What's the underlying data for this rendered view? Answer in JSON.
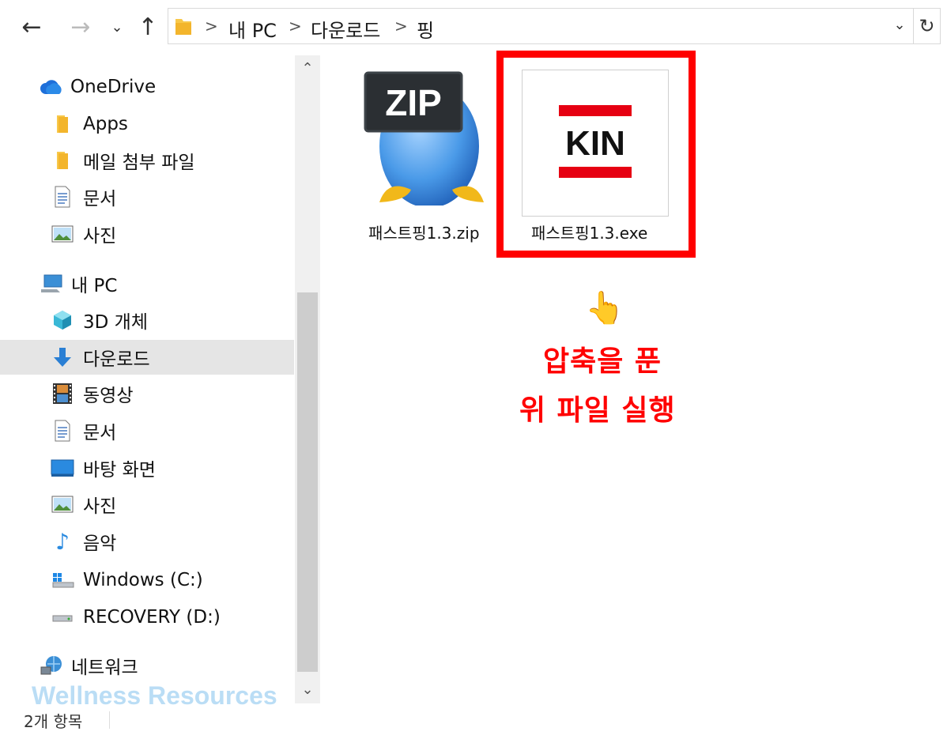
{
  "address_bar": {
    "back_icon": "←",
    "forward_icon": "→",
    "history_icon": "⌄",
    "up_icon": "↑",
    "crumbs": [
      "내 PC",
      "다운로드",
      "핑"
    ],
    "separator": ">",
    "dropdown_icon": "⌄",
    "refresh_icon": "↻"
  },
  "nav": {
    "items": [
      {
        "label": "OneDrive",
        "icon": "onedrive-cloud-icon"
      },
      {
        "label": "Apps",
        "icon": "folder-icon"
      },
      {
        "label": "메일 첨부 파일",
        "icon": "folder-icon"
      },
      {
        "label": "문서",
        "icon": "document-icon"
      },
      {
        "label": "사진",
        "icon": "picture-icon"
      },
      {
        "label": "내 PC",
        "icon": "computer-icon"
      },
      {
        "label": "3D 개체",
        "icon": "cube-icon"
      },
      {
        "label": "다운로드",
        "icon": "download-arrow-icon",
        "selected": true
      },
      {
        "label": "동영상",
        "icon": "film-icon"
      },
      {
        "label": "문서",
        "icon": "document-icon"
      },
      {
        "label": "바탕 화면",
        "icon": "desktop-icon"
      },
      {
        "label": "사진",
        "icon": "picture-icon"
      },
      {
        "label": "음악",
        "icon": "music-note-icon"
      },
      {
        "label": "Windows (C:)",
        "icon": "windows-drive-icon"
      },
      {
        "label": "RECOVERY (D:)",
        "icon": "drive-icon"
      },
      {
        "label": "네트워크",
        "icon": "network-icon"
      }
    ]
  },
  "scrollbar": {
    "up": "⌃",
    "down": "⌄"
  },
  "files": [
    {
      "name": "패스트핑1.3.zip",
      "icon": "zip-archive-icon",
      "badge": "ZIP"
    },
    {
      "name": "패스트핑1.3.exe",
      "icon": "kin-app-icon",
      "badge": "KIN"
    }
  ],
  "annotation": {
    "hand": "👆",
    "line1": "압축을 푼",
    "line2": "위 파일 실행",
    "color": "#ff0000"
  },
  "watermark": "Wellness Resources",
  "status": {
    "item_count": "2개 항목"
  }
}
